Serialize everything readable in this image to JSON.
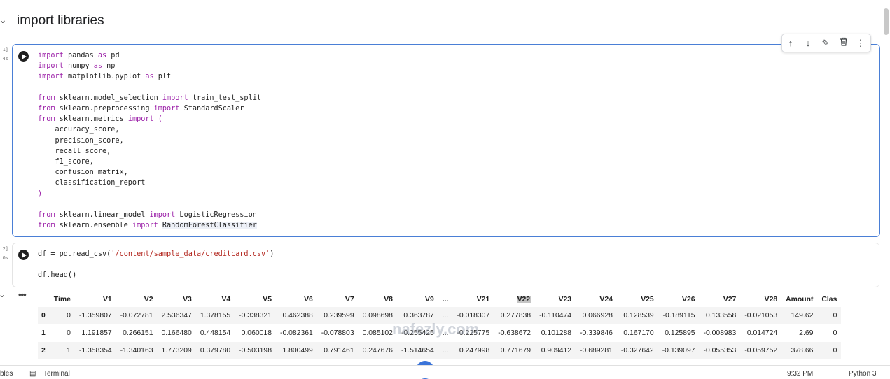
{
  "section": {
    "title": "import libraries"
  },
  "cell1": {
    "exec_label": "1]",
    "exec_time": "4s",
    "lines": [
      [
        {
          "t": "import",
          "c": "kw"
        },
        {
          "t": " pandas "
        },
        {
          "t": "as",
          "c": "kw"
        },
        {
          "t": " pd"
        }
      ],
      [
        {
          "t": "import",
          "c": "kw"
        },
        {
          "t": " numpy "
        },
        {
          "t": "as",
          "c": "kw"
        },
        {
          "t": " np"
        }
      ],
      [
        {
          "t": "import",
          "c": "kw"
        },
        {
          "t": " matplotlib.pyplot "
        },
        {
          "t": "as",
          "c": "kw"
        },
        {
          "t": " plt"
        }
      ],
      [],
      [
        {
          "t": "from",
          "c": "kw"
        },
        {
          "t": " sklearn.model_selection "
        },
        {
          "t": "import",
          "c": "kw"
        },
        {
          "t": " train_test_split"
        }
      ],
      [
        {
          "t": "from",
          "c": "kw"
        },
        {
          "t": " sklearn.preprocessing "
        },
        {
          "t": "import",
          "c": "kw"
        },
        {
          "t": " StandardScaler"
        }
      ],
      [
        {
          "t": "from",
          "c": "kw"
        },
        {
          "t": " sklearn.metrics "
        },
        {
          "t": "import",
          "c": "kw"
        },
        {
          "t": " "
        },
        {
          "t": "(",
          "c": "kw"
        }
      ],
      [
        {
          "t": "    accuracy_score,"
        }
      ],
      [
        {
          "t": "    precision_score,"
        }
      ],
      [
        {
          "t": "    recall_score,"
        }
      ],
      [
        {
          "t": "    f1_score,"
        }
      ],
      [
        {
          "t": "    confusion_matrix,"
        }
      ],
      [
        {
          "t": "    classification_report"
        }
      ],
      [
        {
          "t": ")",
          "c": "kw"
        }
      ],
      [],
      [
        {
          "t": "from",
          "c": "kw"
        },
        {
          "t": " sklearn.linear_model "
        },
        {
          "t": "import",
          "c": "kw"
        },
        {
          "t": " LogisticRegression"
        }
      ],
      [
        {
          "t": "from",
          "c": "kw"
        },
        {
          "t": " sklearn.ensemble "
        },
        {
          "t": "import",
          "c": "kw"
        },
        {
          "t": " "
        },
        {
          "t": "RandomForestClassifier",
          "c": "hl"
        }
      ]
    ]
  },
  "cell2": {
    "exec_label": "2]",
    "exec_time": "0s",
    "lines": [
      [
        {
          "t": "df = pd.read_csv("
        },
        {
          "t": "'/content/sample_data/creditcard.csv'",
          "c": "str"
        },
        {
          "t": ")"
        }
      ],
      [],
      [
        {
          "t": "df.head()"
        }
      ]
    ]
  },
  "toolbar": {
    "icons": [
      "arrow-up-icon",
      "arrow-down-icon",
      "edit-icon",
      "trash-icon",
      "more-icon"
    ],
    "glyphs": [
      "↑",
      "↓",
      "✎",
      "⌂",
      "⋮"
    ]
  },
  "output": {
    "more_label": "•••",
    "columns": [
      "",
      "Time",
      "V1",
      "V2",
      "V3",
      "V4",
      "V5",
      "V6",
      "V7",
      "V8",
      "V9",
      "...",
      "V21",
      "V22",
      "V23",
      "V24",
      "V25",
      "V26",
      "V27",
      "V28",
      "Amount",
      "Clas"
    ],
    "rows": [
      [
        "0",
        "0",
        "-1.359807",
        "-0.072781",
        "2.536347",
        "1.378155",
        "-0.338321",
        "0.462388",
        "0.239599",
        "0.098698",
        "0.363787",
        "...",
        "-0.018307",
        "0.277838",
        "-0.110474",
        "0.066928",
        "0.128539",
        "-0.189115",
        "0.133558",
        "-0.021053",
        "149.62",
        "0"
      ],
      [
        "1",
        "0",
        "1.191857",
        "0.266151",
        "0.166480",
        "0.448154",
        "0.060018",
        "-0.082361",
        "-0.078803",
        "0.085102",
        "-0.255425",
        "...",
        "-0.225775",
        "-0.638672",
        "0.101288",
        "-0.339846",
        "0.167170",
        "0.125895",
        "-0.008983",
        "0.014724",
        "2.69",
        "0"
      ],
      [
        "2",
        "1",
        "-1.358354",
        "-1.340163",
        "1.773209",
        "0.379780",
        "-0.503198",
        "1.800499",
        "0.791461",
        "0.247676",
        "-1.514654",
        "...",
        "0.247998",
        "0.771679",
        "0.909412",
        "-0.689281",
        "-0.327642",
        "-0.139097",
        "-0.055353",
        "-0.059752",
        "378.66",
        "0"
      ]
    ]
  },
  "bottom_bar": {
    "left": "bles",
    "terminal": "Terminal",
    "time": "9:32 PM",
    "runtime": "Python 3"
  },
  "watermark": "nafezly.com"
}
